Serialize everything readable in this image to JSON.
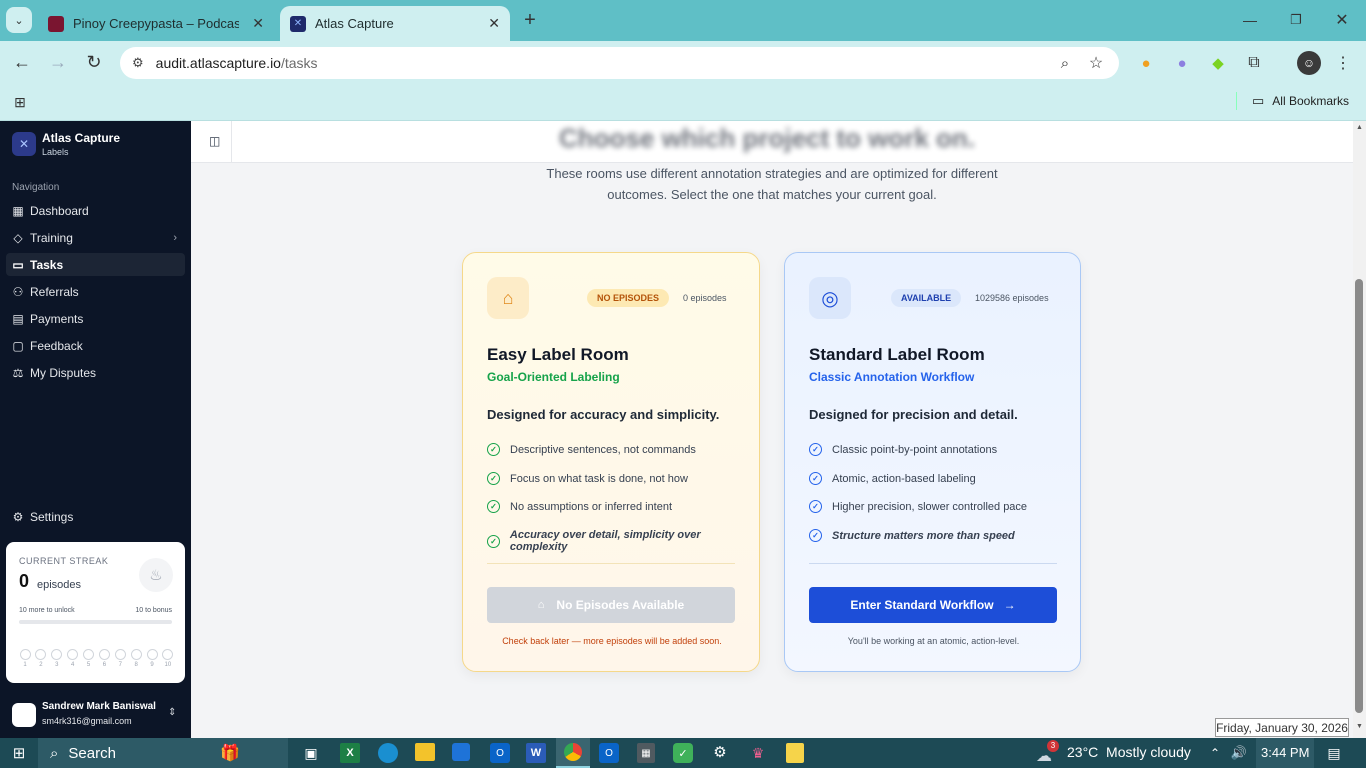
{
  "browser": {
    "tabs": [
      {
        "title": "Pinoy Creepypasta – Podcast or",
        "active": false
      },
      {
        "title": "Atlas Capture",
        "active": true
      }
    ],
    "url_host": "audit.atlascapture.io",
    "url_path": "/tasks",
    "bookmarks_label": "All Bookmarks"
  },
  "app": {
    "name": "Atlas Capture",
    "subtitle": "Labels",
    "nav_heading": "Navigation",
    "nav": [
      {
        "label": "Dashboard",
        "icon": "grid-icon"
      },
      {
        "label": "Training",
        "icon": "graduation-cap-icon"
      },
      {
        "label": "Tasks",
        "icon": "video-icon",
        "active": true
      },
      {
        "label": "Referrals",
        "icon": "users-icon"
      },
      {
        "label": "Payments",
        "icon": "receipt-icon"
      },
      {
        "label": "Feedback",
        "icon": "message-icon"
      },
      {
        "label": "My Disputes",
        "icon": "scale-icon"
      }
    ],
    "settings_label": "Settings",
    "streak": {
      "title": "CURRENT STREAK",
      "count": "0",
      "unit": "episodes",
      "unlock_text": "10 more to unlock",
      "bonus_text": "10 to bonus",
      "progress": 0,
      "steps": [
        "1",
        "2",
        "3",
        "4",
        "5",
        "6",
        "7",
        "8",
        "9",
        "10"
      ]
    },
    "user": {
      "name": "Sandrew Mark Baniswal",
      "email": "sm4rk316@gmail.com"
    }
  },
  "page": {
    "heading_partial": "Choose which project to work on.",
    "intro_line1": "These rooms use different annotation strategies and are optimized for different",
    "intro_line2": "outcomes. Select the one that matches your current goal."
  },
  "rooms": [
    {
      "badge": "NO EPISODES",
      "episodes": "0 episodes",
      "title": "Easy Label Room",
      "subtitle": "Goal-Oriented Labeling",
      "tagline": "Designed for accuracy and simplicity.",
      "features": [
        "Descriptive sentences, not commands",
        "Focus on what task is done, not how",
        "No assumptions or inferred intent",
        "Accuracy over detail, simplicity over complexity"
      ],
      "button": "No Episodes Available",
      "note": "Check back later — more episodes will be added soon.",
      "accent": "#16a34a"
    },
    {
      "badge": "AVAILABLE",
      "episodes": "1029586 episodes",
      "title": "Standard Label Room",
      "subtitle": "Classic Annotation Workflow",
      "tagline": "Designed for precision and detail.",
      "features": [
        "Classic point-by-point annotations",
        "Atomic, action-based labeling",
        "Higher precision, slower controlled pace",
        "Structure matters more than speed"
      ],
      "button": "Enter Standard Workflow",
      "note": "You'll be working at an atomic, action-level.",
      "accent": "#2563eb"
    }
  ],
  "tooltip": "Friday, January 30, 2026",
  "taskbar": {
    "search": "Search",
    "weather": "23°C  Mostly cloudy",
    "weather_badge": "3",
    "time": "3:44 PM"
  }
}
